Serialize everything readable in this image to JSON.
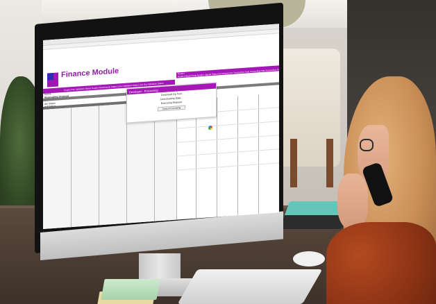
{
  "screen": {
    "app_title": "Finance Module",
    "side_labels": [
      "nance",
      "Receivables Invoices",
      "tails",
      "der  Status",
      "null  Status"
    ],
    "header_row": "Header Doc Validation Status    Header Attachments Status    Lines Validation Status    Line Doc Validation Status",
    "header_row_right": "Header",
    "header_row_right_sub": "Header Attachments  Header Upload Status  Documents Doc  Transaction Date  Accounting Date  Transaction Process",
    "dialog": {
      "title": "Developer - Processing",
      "lines": [
        "Download Zip from",
        "Downloading Data...",
        "Executing Request"
      ],
      "button": "Cancel Processing"
    }
  },
  "colors": {
    "brand_purple": "#a517b7",
    "logo_blue": "#2d2bb8"
  }
}
